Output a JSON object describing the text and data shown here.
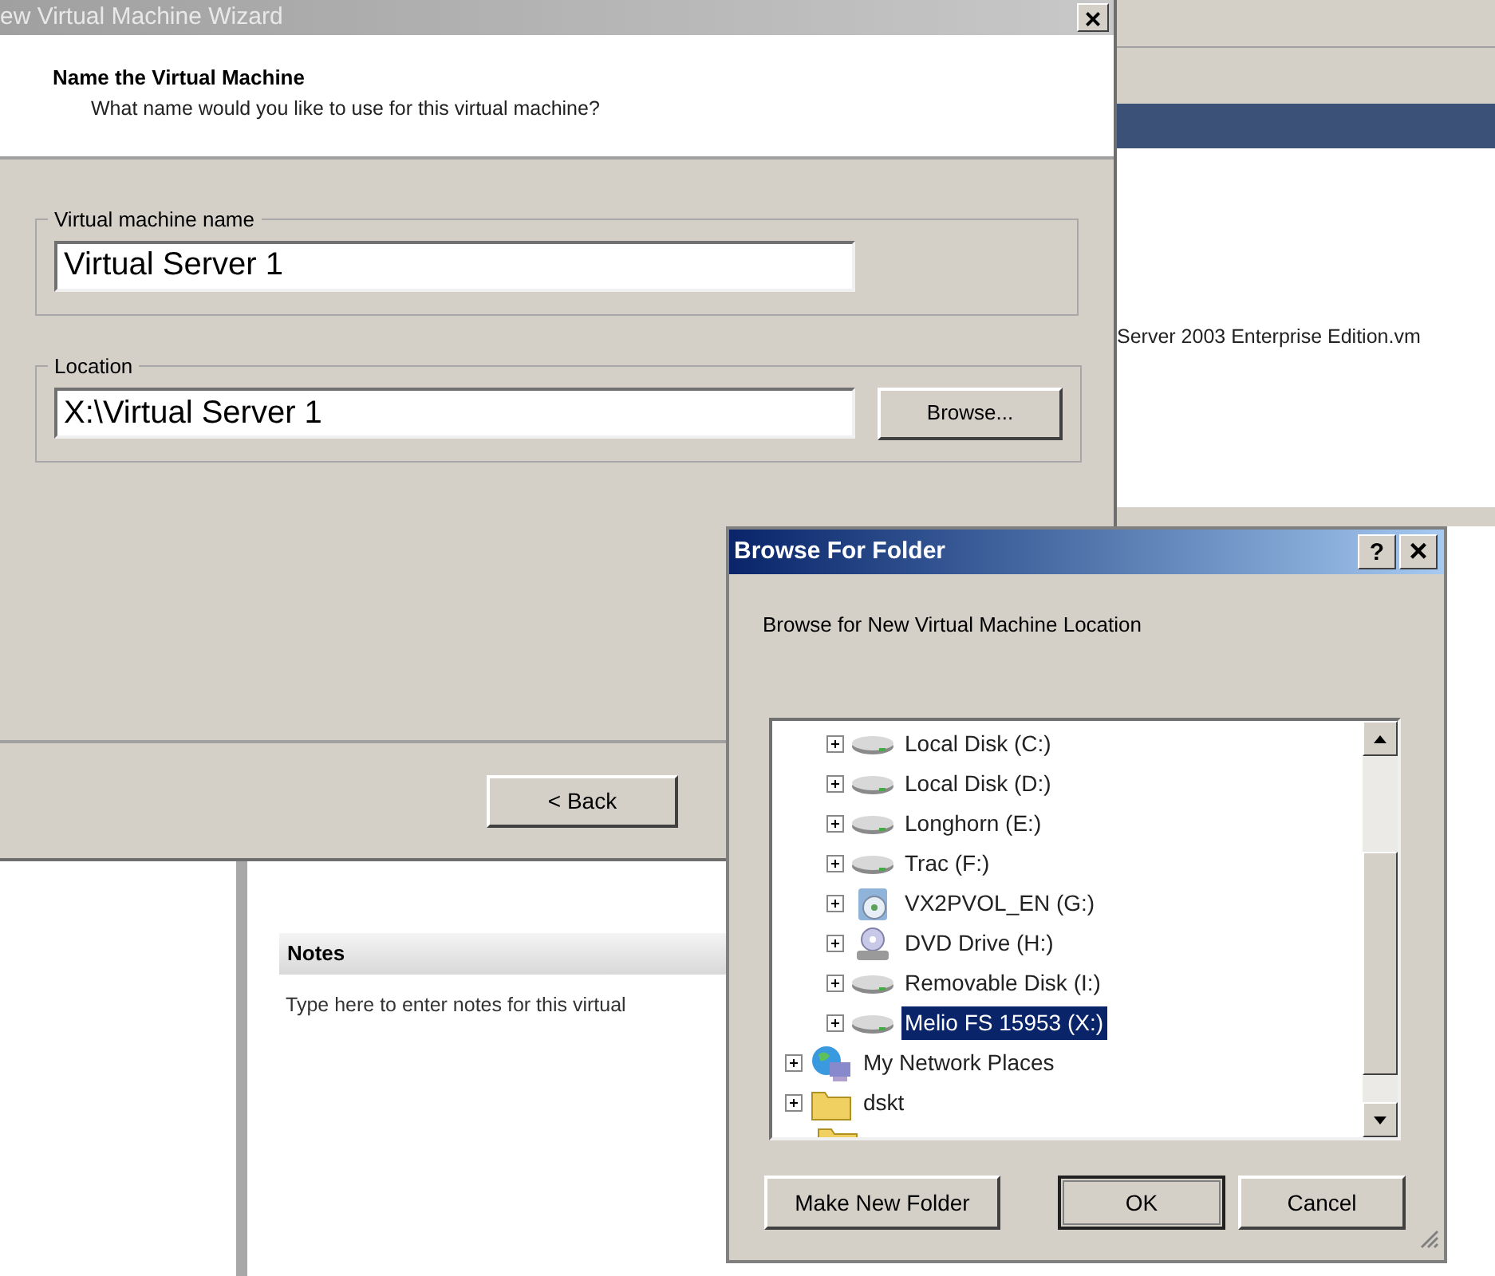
{
  "background_app": {
    "file_name": "Server 2003 Enterprise Edition.vm",
    "notes": {
      "title": "Notes",
      "placeholder": "Type here to enter notes for this virtual"
    }
  },
  "wizard": {
    "title": "ew Virtual Machine Wizard",
    "close": "×",
    "heading": "Name the Virtual Machine",
    "subheading": "What name would you like to use for this virtual machine?",
    "name_group": {
      "label": "Virtual machine name",
      "value": "Virtual Server 1"
    },
    "location_group": {
      "label": "Location",
      "value": "X:\\Virtual Server 1",
      "button": {
        "label": "Browse..."
      }
    },
    "back_button": {
      "label": "< Back"
    }
  },
  "browse_dialog": {
    "title": "Browse For Folder",
    "help": "?",
    "close": "×",
    "prompt": "Browse for New Virtual Machine Location",
    "tree": [
      {
        "children": [
          {
            "kind": "drive",
            "label": "Local Disk (C:)",
            "expanded": false,
            "selected": false
          },
          {
            "kind": "drive",
            "label": "Local Disk (D:)",
            "expanded": false,
            "selected": false
          },
          {
            "kind": "drive",
            "label": "Longhorn (E:)",
            "expanded": false,
            "selected": false
          },
          {
            "kind": "drive",
            "label": "Trac (F:)",
            "expanded": false,
            "selected": false
          },
          {
            "kind": "cd",
            "label": "VX2PVOL_EN (G:)",
            "expanded": false,
            "selected": false
          },
          {
            "kind": "dvd",
            "label": "DVD Drive (H:)",
            "expanded": false,
            "selected": false
          },
          {
            "kind": "drive",
            "label": "Removable Disk (I:)",
            "expanded": false,
            "selected": false
          },
          {
            "kind": "drive",
            "label": "Melio FS 15953 (X:)",
            "expanded": false,
            "selected": true
          }
        ]
      },
      {
        "kind": "network",
        "label": "My Network Places",
        "expanded": false,
        "selected": false
      },
      {
        "kind": "folder",
        "label": "dskt",
        "expanded": false,
        "selected": false
      },
      {
        "kind": "folder"
      }
    ],
    "buttons": [
      {
        "label": "Make New Folder",
        "default": false
      },
      {
        "label": "OK",
        "default": true
      },
      {
        "label": "Cancel",
        "default": false
      }
    ]
  }
}
